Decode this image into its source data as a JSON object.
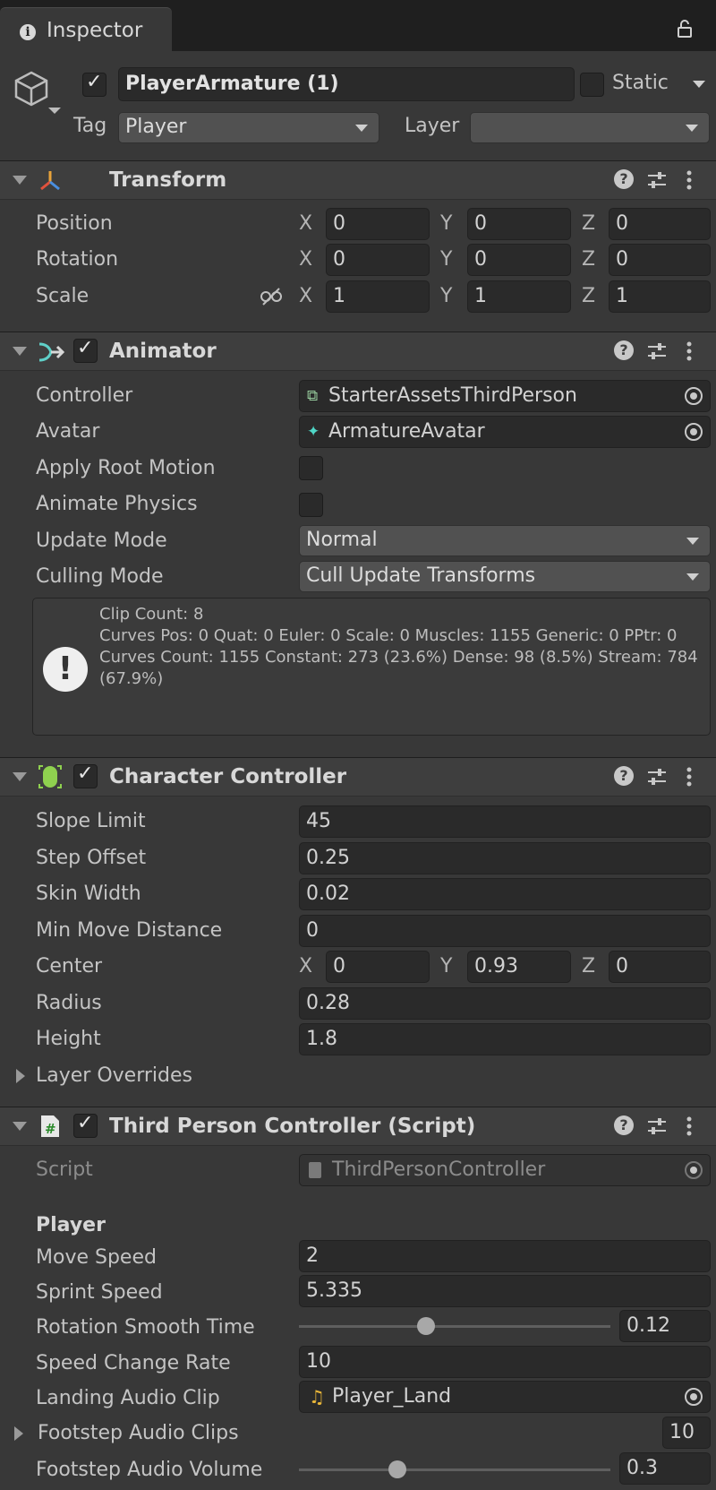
{
  "window": {
    "tab_label": "Inspector"
  },
  "object": {
    "name": "PlayerArmature (1)",
    "static_label": "Static",
    "tag_label": "Tag",
    "tag_value": "Player",
    "layer_label": "Layer",
    "layer_value": ""
  },
  "transform": {
    "title": "Transform",
    "position_label": "Position",
    "rotation_label": "Rotation",
    "scale_label": "Scale",
    "axis_x": "X",
    "axis_y": "Y",
    "axis_z": "Z",
    "position": [
      "0",
      "0",
      "0"
    ],
    "rotation": [
      "0",
      "0",
      "0"
    ],
    "scale": [
      "1",
      "1",
      "1"
    ]
  },
  "animator": {
    "title": "Animator",
    "controller_label": "Controller",
    "controller_value": "StarterAssetsThirdPerson",
    "avatar_label": "Avatar",
    "avatar_value": "ArmatureAvatar",
    "apply_root_motion_label": "Apply Root Motion",
    "animate_physics_label": "Animate Physics",
    "update_mode_label": "Update Mode",
    "update_mode_value": "Normal",
    "culling_mode_label": "Culling Mode",
    "culling_mode_value": "Cull Update Transforms",
    "info_line1": "Clip Count: 8",
    "info_line2": "Curves Pos: 0 Quat: 0 Euler: 0 Scale: 0 Muscles: 1155 Generic: 0 PPtr: 0",
    "info_line3": "Curves Count: 1155 Constant: 273 (23.6%) Dense: 98 (8.5%) Stream: 784 (67.9%)"
  },
  "character_controller": {
    "title": "Character Controller",
    "slope_limit_label": "Slope Limit",
    "slope_limit": "45",
    "step_offset_label": "Step Offset",
    "step_offset": "0.25",
    "skin_width_label": "Skin Width",
    "skin_width": "0.02",
    "min_move_label": "Min Move Distance",
    "min_move": "0",
    "center_label": "Center",
    "center": [
      "0",
      "0.93",
      "0"
    ],
    "radius_label": "Radius",
    "radius": "0.28",
    "height_label": "Height",
    "height": "1.8",
    "layer_overrides_label": "Layer Overrides"
  },
  "third_person": {
    "title": "Third Person Controller (Script)",
    "script_label": "Script",
    "script_value": "ThirdPersonController",
    "player_header": "Player",
    "move_speed_label": "Move Speed",
    "move_speed": "2",
    "sprint_speed_label": "Sprint Speed",
    "sprint_speed": "5.335",
    "rotation_smooth_label": "Rotation Smooth Time",
    "rotation_smooth": "0.12",
    "speed_change_label": "Speed Change Rate",
    "speed_change": "10",
    "landing_audio_label": "Landing Audio Clip",
    "landing_audio": "Player_Land",
    "footstep_clips_label": "Footstep Audio Clips",
    "footstep_clips": "10",
    "footstep_volume_label": "Footstep Audio Volume",
    "footstep_volume": "0.3"
  }
}
